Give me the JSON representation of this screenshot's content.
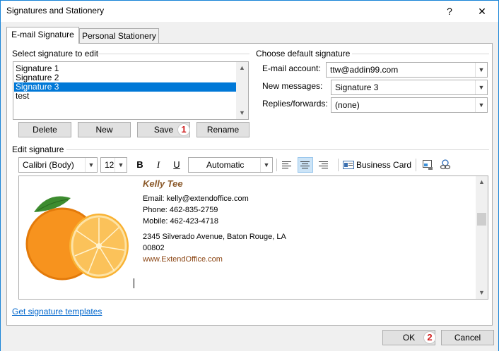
{
  "window": {
    "title": "Signatures and Stationery",
    "help": "?",
    "close": "✕"
  },
  "tabs": [
    "E-mail Signature",
    "Personal Stationery"
  ],
  "select_section": {
    "label": "Select signature to edit",
    "items": [
      "Signature 1",
      "Signature 2",
      "Signature 3",
      "test"
    ],
    "selected": "Signature 3"
  },
  "buttons": {
    "delete": "Delete",
    "new": "New",
    "save": "Save",
    "rename": "Rename"
  },
  "badges": {
    "one": "1",
    "two": "2"
  },
  "default_section": {
    "label": "Choose default signature",
    "email_label": "E-mail account:",
    "email_value": "ttw@addin99.com",
    "new_label": "New messages:",
    "new_value": "Signature 3",
    "replies_label": "Replies/forwards:",
    "replies_value": "(none)"
  },
  "edit_section": {
    "label": "Edit signature",
    "font": "Calibri (Body)",
    "size": "12",
    "bold": "B",
    "italic": "I",
    "underline": "U",
    "color": "Automatic",
    "business_card": "Business Card"
  },
  "signature": {
    "name": "Kelly Tee",
    "email": "Email: kelly@extendoffice.com",
    "phone": "Phone: 462-835-2759",
    "mobile": "Mobile: 462-423-4718",
    "address": "2345 Silverado Avenue, Baton Rouge, LA",
    "zip": "00802",
    "website": "www.ExtendOffice.com"
  },
  "templates_link": "Get signature templates",
  "footer": {
    "ok": "OK",
    "cancel": "Cancel"
  },
  "colors": {
    "accent": "#0078d7",
    "name": "#8b5a2b",
    "website": "#8b4513",
    "badge": "#d01f1f"
  }
}
